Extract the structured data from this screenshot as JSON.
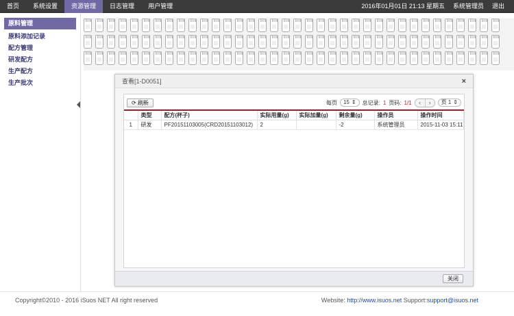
{
  "topnav": {
    "items": [
      "首页",
      "系统设置",
      "资源管理",
      "日志管理",
      "用户管理"
    ],
    "active": 2,
    "datetime": "2016年01月01日 21:13 星期五",
    "user": "系统管理员",
    "logout": "退出"
  },
  "sidebar": {
    "items": [
      "原料管理",
      "原料添加记录",
      "配方管理",
      "研发配方",
      "生产配方",
      "生产批次"
    ],
    "active": 0
  },
  "dialog": {
    "title": "查看[1-D0051]",
    "close_icon": "×",
    "refresh_label": "刷新",
    "pager": {
      "per_page_label": "每页",
      "per_page_value": "15",
      "total_label": "总记录:",
      "total_value": "1",
      "page_label": "页码:",
      "page_value": "1/1",
      "prev_icon": "‹",
      "next_icon": "›",
      "page_select": "页 1"
    },
    "table": {
      "columns": [
        "",
        "类型",
        "配方(杯子)",
        "实际用量(g)",
        "实际加量(g)",
        "剩余量(g)",
        "操作员",
        "操作时间"
      ],
      "rows": [
        [
          "1",
          "研发",
          "PF20151103005(CRD20151103012)",
          "2",
          "",
          "-2",
          "系统管理员",
          "2015-11-03 15:11"
        ]
      ]
    },
    "close_label": "关闭"
  },
  "footer": {
    "copyright": "Copyright©2010 - 2016 iSuos NET All right reserved",
    "website_label": "Website: ",
    "website_url": "http://www.isuos.net",
    "support_label": " Support:",
    "support_email": "support@isuos.net"
  }
}
